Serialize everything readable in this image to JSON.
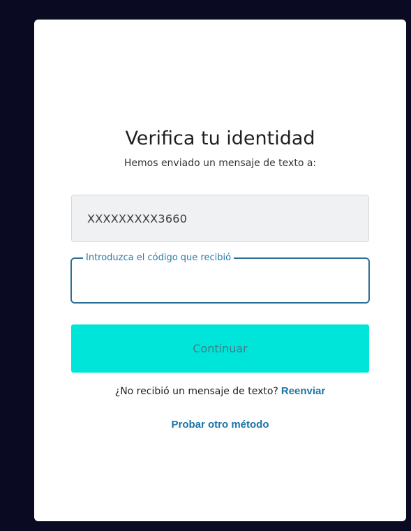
{
  "colors": {
    "backdrop": "#0a0a23",
    "card": "#ffffff",
    "accent_button": "#00e5da",
    "button_text": "#3d7f85",
    "link": "#1b75a6",
    "focus_border": "#2b6f96"
  },
  "verify": {
    "title": "Verifica tu identidad",
    "subtitle": "Hemos enviado un mensaje de texto a:",
    "phone_value": "XXXXXXXXX3660",
    "code_field": {
      "label": "Introduzca el código que recibió",
      "value": ""
    },
    "continue_label": "Continuar",
    "resend_prompt": "¿No recibió un mensaje de texto?",
    "resend_link": "Reenviar",
    "other_method_link": "Probar otro método"
  }
}
